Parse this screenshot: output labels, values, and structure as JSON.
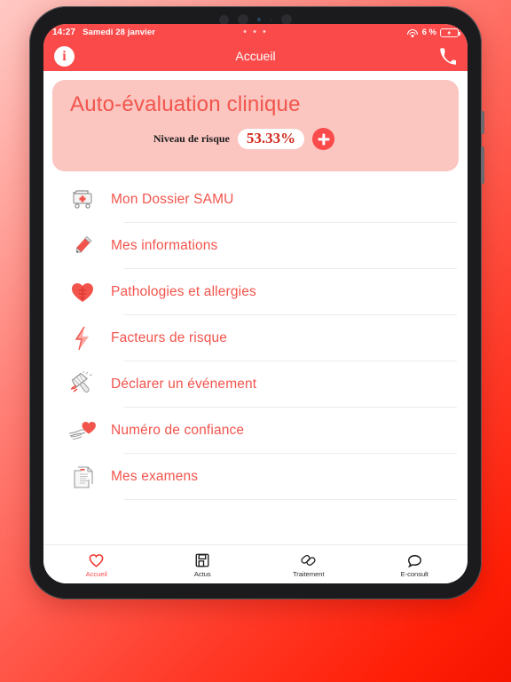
{
  "status_bar": {
    "time": "14:27",
    "date": "Samedi 28 janvier",
    "center_indicator": "• • •",
    "battery_percent": "6 %",
    "wifi_icon": "wifi-icon",
    "battery_icon": "battery-charging-icon"
  },
  "nav_bar": {
    "title": "Accueil",
    "left_icon": "info-icon",
    "right_icon": "phone-icon"
  },
  "risk_card": {
    "title": "Auto-évaluation clinique",
    "risk_label": "Niveau de risque",
    "risk_value": "53.33%",
    "add_button": "+",
    "card_color": "#fbc5c0",
    "accent_color": "#f2544c"
  },
  "menu": {
    "items": [
      {
        "label": "Mon Dossier SAMU",
        "icon": "medical-cart-icon"
      },
      {
        "label": "Mes informations",
        "icon": "pencil-icon"
      },
      {
        "label": "Pathologies et allergies",
        "icon": "heart-icon"
      },
      {
        "label": "Facteurs de risque",
        "icon": "lightning-bolt-icon"
      },
      {
        "label": "Déclarer un événement",
        "icon": "alert-hammer-icon"
      },
      {
        "label": "Numéro de confiance",
        "icon": "hand-heart-icon"
      },
      {
        "label": "Mes examens",
        "icon": "documents-icon"
      }
    ]
  },
  "tab_bar": {
    "tabs": [
      {
        "label": "Accueil",
        "icon": "heart-outline-icon",
        "active": true
      },
      {
        "label": "Actus",
        "icon": "newspaper-icon",
        "active": false
      },
      {
        "label": "Traitement",
        "icon": "pills-icon",
        "active": false
      },
      {
        "label": "E-consult",
        "icon": "chat-bubble-icon",
        "active": false
      }
    ]
  },
  "theme": {
    "brand_red": "#fa4a4a",
    "background_gradient_start": "#ffc9c4",
    "background_gradient_end": "#f51500"
  }
}
